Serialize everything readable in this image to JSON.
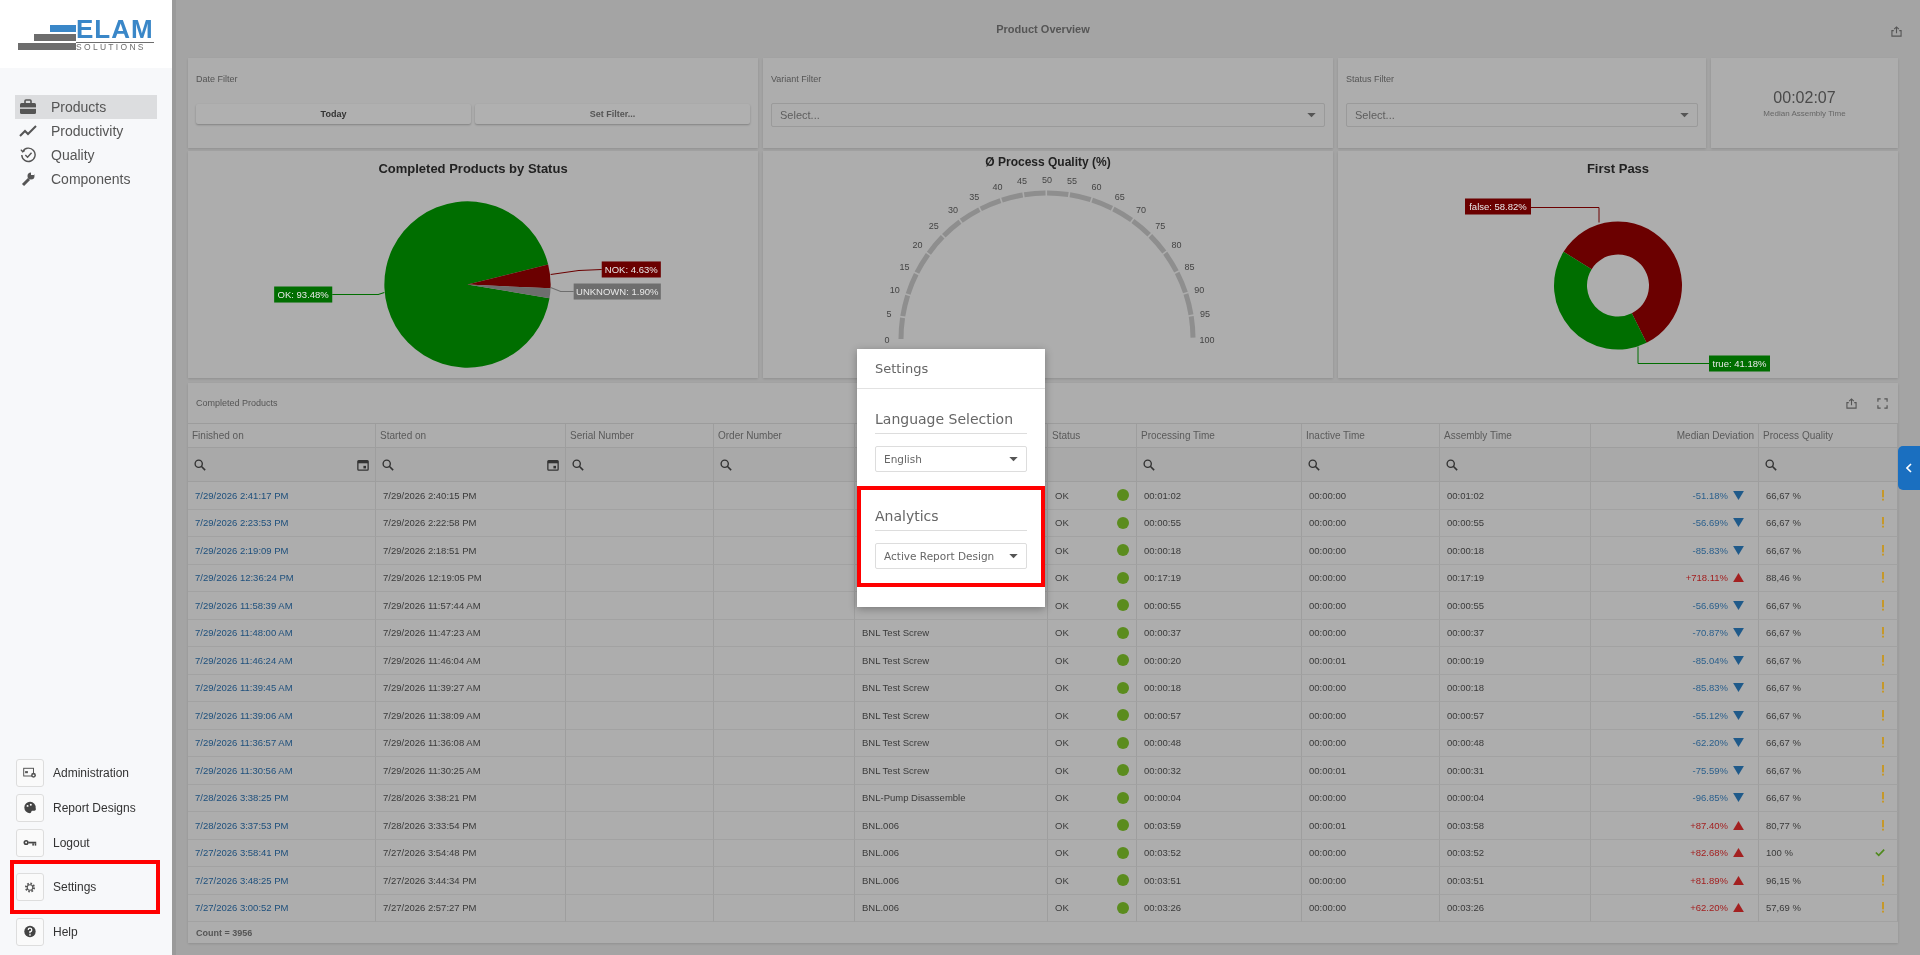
{
  "sidebar": {
    "logo": {
      "title": "ELAM",
      "subtitle": "SOLUTIONS"
    },
    "nav": [
      {
        "label": "Products",
        "selected": true
      },
      {
        "label": "Productivity",
        "selected": false
      },
      {
        "label": "Quality",
        "selected": false
      },
      {
        "label": "Components",
        "selected": false
      }
    ],
    "bottom": [
      {
        "label": "Administration",
        "highlighted": false
      },
      {
        "label": "Report Designs",
        "highlighted": false
      },
      {
        "label": "Logout",
        "highlighted": false
      },
      {
        "label": "Settings",
        "highlighted": true
      },
      {
        "label": "Help",
        "highlighted": false
      }
    ]
  },
  "header": {
    "title": "Product Overview"
  },
  "filters": {
    "date": {
      "label": "Date Filter",
      "buttons": [
        {
          "label": "Today",
          "selected": true
        },
        {
          "label": "Set Filter...",
          "selected": false
        }
      ]
    },
    "variant": {
      "label": "Variant Filter",
      "placeholder": "Select..."
    },
    "status": {
      "label": "Status Filter",
      "placeholder": "Select..."
    }
  },
  "kpi": {
    "value": "00:02:07",
    "label": "Median Assembly Time"
  },
  "status_chart": {
    "chart_data": {
      "type": "pie",
      "title": "Completed Products by Status",
      "values": [
        93.48,
        4.63,
        1.9
      ],
      "colors": [
        "#006e00",
        "#6b0000",
        "#6e6e6e"
      ],
      "value_labels": [
        "OK: 93.48%",
        "NOK: 4.63%",
        "UNKNOWN: 1.90%"
      ]
    }
  },
  "gauge": {
    "title": "Ø Process Quality (%)",
    "ticks": [
      "0",
      "5",
      "10",
      "15",
      "20",
      "25",
      "30",
      "35",
      "40",
      "45",
      "50",
      "55",
      "60",
      "65",
      "70",
      "75",
      "80",
      "85",
      "90",
      "95",
      "100"
    ]
  },
  "first_pass_chart": {
    "chart_data": {
      "type": "donut",
      "title": "First Pass",
      "values": [
        58.82,
        41.18
      ],
      "colors": [
        "#6b0000",
        "#006e00"
      ],
      "value_labels": [
        "false: 58.82%",
        "true: 41.18%"
      ]
    }
  },
  "table": {
    "title": "Completed Products",
    "columns": [
      {
        "label": "Finished on",
        "kind": "date"
      },
      {
        "label": "Started on",
        "kind": "date"
      },
      {
        "label": "Serial Number",
        "kind": "search"
      },
      {
        "label": "Order Number",
        "kind": "search"
      },
      {
        "kind": "plain"
      },
      {
        "label": "Status",
        "kind": "plain"
      },
      {
        "label": "Processing Time",
        "kind": "search"
      },
      {
        "label": "Inactive Time",
        "kind": "search"
      },
      {
        "label": "Assembly Time",
        "kind": "search"
      },
      {
        "label": "Median Deviation",
        "kind": "plain"
      },
      {
        "label": "Process Quality",
        "kind": "search"
      }
    ],
    "rows": [
      {
        "finished_on": "7/29/2026 2:41:17 PM",
        "started_on": "7/29/2026 2:40:15 PM",
        "status": "OK",
        "color": "#5b8c1e",
        "processing_time": "00:01:02",
        "inactive_time": "00:00:00",
        "assembly_time": "00:01:02",
        "median_deviation": {
          "text": "-51.18%",
          "kind": "down"
        },
        "process_quality": {
          "text": "66,67 %",
          "kind": "warning"
        }
      },
      {
        "finished_on": "7/29/2026 2:23:53 PM",
        "started_on": "7/29/2026 2:22:58 PM",
        "status": "OK",
        "color": "#5b8c1e",
        "processing_time": "00:00:55",
        "inactive_time": "00:00:00",
        "assembly_time": "00:00:55",
        "median_deviation": {
          "text": "-56.69%",
          "kind": "down"
        },
        "process_quality": {
          "text": "66,67 %",
          "kind": "warning"
        }
      },
      {
        "finished_on": "7/29/2026 2:19:09 PM",
        "started_on": "7/29/2026 2:18:51 PM",
        "status": "OK",
        "color": "#5b8c1e",
        "processing_time": "00:00:18",
        "inactive_time": "00:00:00",
        "assembly_time": "00:00:18",
        "median_deviation": {
          "text": "-85.83%",
          "kind": "down"
        },
        "process_quality": {
          "text": "66,67 %",
          "kind": "warning"
        }
      },
      {
        "finished_on": "7/29/2026 12:36:24 PM",
        "started_on": "7/29/2026 12:19:05 PM",
        "status": "OK",
        "color": "#5b8c1e",
        "processing_time": "00:17:19",
        "inactive_time": "00:00:00",
        "assembly_time": "00:17:19",
        "median_deviation": {
          "text": "+718.11%",
          "kind": "up"
        },
        "process_quality": {
          "text": "88,46 %",
          "kind": "warning"
        }
      },
      {
        "finished_on": "7/29/2026 11:58:39 AM",
        "started_on": "7/29/2026 11:57:44 AM",
        "status": "OK",
        "color": "#5b8c1e",
        "processing_time": "00:00:55",
        "inactive_time": "00:00:00",
        "assembly_time": "00:00:55",
        "median_deviation": {
          "text": "-56.69%",
          "kind": "down"
        },
        "process_quality": {
          "text": "66,67 %",
          "kind": "warning"
        }
      },
      {
        "finished_on": "7/29/2026 11:48:00 AM",
        "started_on": "7/29/2026 11:47:23 AM",
        "variant": "BNL Test Screw",
        "status": "OK",
        "color": "#5b8c1e",
        "processing_time": "00:00:37",
        "inactive_time": "00:00:00",
        "assembly_time": "00:00:37",
        "median_deviation": {
          "text": "-70.87%",
          "kind": "down"
        },
        "process_quality": {
          "text": "66,67 %",
          "kind": "warning"
        }
      },
      {
        "finished_on": "7/29/2026 11:46:24 AM",
        "started_on": "7/29/2026 11:46:04 AM",
        "variant": "BNL Test Screw",
        "status": "OK",
        "color": "#5b8c1e",
        "processing_time": "00:00:20",
        "inactive_time": "00:00:01",
        "assembly_time": "00:00:19",
        "median_deviation": {
          "text": "-85.04%",
          "kind": "down"
        },
        "process_quality": {
          "text": "66,67 %",
          "kind": "warning"
        }
      },
      {
        "finished_on": "7/29/2026 11:39:45 AM",
        "started_on": "7/29/2026 11:39:27 AM",
        "variant": "BNL Test Screw",
        "status": "OK",
        "color": "#5b8c1e",
        "processing_time": "00:00:18",
        "inactive_time": "00:00:00",
        "assembly_time": "00:00:18",
        "median_deviation": {
          "text": "-85.83%",
          "kind": "down"
        },
        "process_quality": {
          "text": "66,67 %",
          "kind": "warning"
        }
      },
      {
        "finished_on": "7/29/2026 11:39:06 AM",
        "started_on": "7/29/2026 11:38:09 AM",
        "variant": "BNL Test Screw",
        "status": "OK",
        "color": "#5b8c1e",
        "processing_time": "00:00:57",
        "inactive_time": "00:00:00",
        "assembly_time": "00:00:57",
        "median_deviation": {
          "text": "-55.12%",
          "kind": "down"
        },
        "process_quality": {
          "text": "66,67 %",
          "kind": "warning"
        }
      },
      {
        "finished_on": "7/29/2026 11:36:57 AM",
        "started_on": "7/29/2026 11:36:08 AM",
        "variant": "BNL Test Screw",
        "status": "OK",
        "color": "#5b8c1e",
        "processing_time": "00:00:48",
        "inactive_time": "00:00:00",
        "assembly_time": "00:00:48",
        "median_deviation": {
          "text": "-62.20%",
          "kind": "down"
        },
        "process_quality": {
          "text": "66,67 %",
          "kind": "warning"
        }
      },
      {
        "finished_on": "7/29/2026 11:30:56 AM",
        "started_on": "7/29/2026 11:30:25 AM",
        "variant": "BNL Test Screw",
        "status": "OK",
        "color": "#5b8c1e",
        "processing_time": "00:00:32",
        "inactive_time": "00:00:01",
        "assembly_time": "00:00:31",
        "median_deviation": {
          "text": "-75.59%",
          "kind": "down"
        },
        "process_quality": {
          "text": "66,67 %",
          "kind": "warning"
        }
      },
      {
        "finished_on": "7/28/2026 3:38:25 PM",
        "started_on": "7/28/2026 3:38:21 PM",
        "variant": "BNL-Pump Disassemble",
        "status": "OK",
        "color": "#5b8c1e",
        "processing_time": "00:00:04",
        "inactive_time": "00:00:00",
        "assembly_time": "00:00:04",
        "median_deviation": {
          "text": "-96.85%",
          "kind": "down"
        },
        "process_quality": {
          "text": "66,67 %",
          "kind": "warning"
        }
      },
      {
        "finished_on": "7/28/2026 3:37:53 PM",
        "started_on": "7/28/2026 3:33:54 PM",
        "variant": "BNL.006",
        "status": "OK",
        "color": "#5b8c1e",
        "processing_time": "00:03:59",
        "inactive_time": "00:00:01",
        "assembly_time": "00:03:58",
        "median_deviation": {
          "text": "+87.40%",
          "kind": "up"
        },
        "process_quality": {
          "text": "80,77 %",
          "kind": "warning"
        }
      },
      {
        "finished_on": "7/27/2026 3:58:41 PM",
        "started_on": "7/27/2026 3:54:48 PM",
        "variant": "BNL.006",
        "status": "OK",
        "color": "#5b8c1e",
        "processing_time": "00:03:52",
        "inactive_time": "00:00:00",
        "assembly_time": "00:03:52",
        "median_deviation": {
          "text": "+82.68%",
          "kind": "up"
        },
        "process_quality": {
          "text": "100 %",
          "kind": "ok"
        }
      },
      {
        "finished_on": "7/27/2026 3:48:25 PM",
        "started_on": "7/27/2026 3:44:34 PM",
        "variant": "BNL.006",
        "status": "OK",
        "color": "#5b8c1e",
        "processing_time": "00:03:51",
        "inactive_time": "00:00:00",
        "assembly_time": "00:03:51",
        "median_deviation": {
          "text": "+81.89%",
          "kind": "up"
        },
        "process_quality": {
          "text": "96,15 %",
          "kind": "warning"
        }
      },
      {
        "finished_on": "7/27/2026 3:00:52 PM",
        "started_on": "7/27/2026 2:57:27 PM",
        "variant": "BNL.006",
        "status": "OK",
        "color": "#5b8c1e",
        "processing_time": "00:03:26",
        "inactive_time": "00:00:00",
        "assembly_time": "00:03:26",
        "median_deviation": {
          "text": "+62.20%",
          "kind": "up"
        },
        "process_quality": {
          "text": "57,69 %",
          "kind": "warning"
        }
      }
    ],
    "footer": "Count = 3956"
  },
  "dialog": {
    "title": "Settings",
    "sections": [
      {
        "heading": "Language Selection",
        "value": "English",
        "highlighted": false
      },
      {
        "heading": "Analytics",
        "value": "Active Report Design",
        "highlighted": true
      }
    ]
  }
}
